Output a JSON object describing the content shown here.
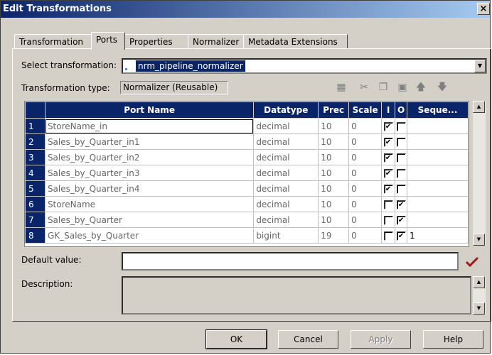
{
  "window": {
    "title": "Edit Transformations",
    "close": "×"
  },
  "tabs": [
    "Transformation",
    "Ports",
    "Properties",
    "Normalizer",
    "Metadata Extensions"
  ],
  "select_transformation": {
    "label": "Select transformation:",
    "value": "nrm_pipeline_normalizer"
  },
  "transformation_type": {
    "label": "Transformation type:",
    "value": "Normalizer (Reusable)"
  },
  "toolbar": [
    "new-port-icon",
    "cut-icon",
    "copy-icon",
    "paste-icon",
    "move-up-icon",
    "move-down-icon"
  ],
  "grid": {
    "headers": [
      "",
      "Port Name",
      "Datatype",
      "Prec",
      "Scale",
      "I",
      "O",
      "Seque..."
    ],
    "rows": [
      {
        "num": "1",
        "name": "StoreName_in",
        "type": "decimal",
        "prec": "10",
        "scale": "0",
        "i": true,
        "o": false,
        "seq": ""
      },
      {
        "num": "2",
        "name": "Sales_by_Quarter_in1",
        "type": "decimal",
        "prec": "10",
        "scale": "0",
        "i": true,
        "o": false,
        "seq": ""
      },
      {
        "num": "3",
        "name": "Sales_by_Quarter_in2",
        "type": "decimal",
        "prec": "10",
        "scale": "0",
        "i": true,
        "o": false,
        "seq": ""
      },
      {
        "num": "4",
        "name": "Sales_by_Quarter_in3",
        "type": "decimal",
        "prec": "10",
        "scale": "0",
        "i": true,
        "o": false,
        "seq": ""
      },
      {
        "num": "5",
        "name": "Sales_by_Quarter_in4",
        "type": "decimal",
        "prec": "10",
        "scale": "0",
        "i": true,
        "o": false,
        "seq": ""
      },
      {
        "num": "6",
        "name": "StoreName",
        "type": "decimal",
        "prec": "10",
        "scale": "0",
        "i": false,
        "o": true,
        "seq": ""
      },
      {
        "num": "7",
        "name": "Sales_by_Quarter",
        "type": "decimal",
        "prec": "10",
        "scale": "0",
        "i": false,
        "o": true,
        "seq": ""
      },
      {
        "num": "8",
        "name": "GK_Sales_by_Quarter",
        "type": "bigint",
        "prec": "19",
        "scale": "0",
        "i": false,
        "o": true,
        "seq": "1"
      }
    ]
  },
  "default_value": {
    "label": "Default value:",
    "value": ""
  },
  "description": {
    "label": "Description:",
    "value": ""
  },
  "buttons": {
    "ok": "OK",
    "cancel": "Cancel",
    "apply": "Apply",
    "help": "Help"
  },
  "colors": {
    "title_start": "#0a246a",
    "title_end": "#a6caf0",
    "validate_check": "#a01818"
  }
}
